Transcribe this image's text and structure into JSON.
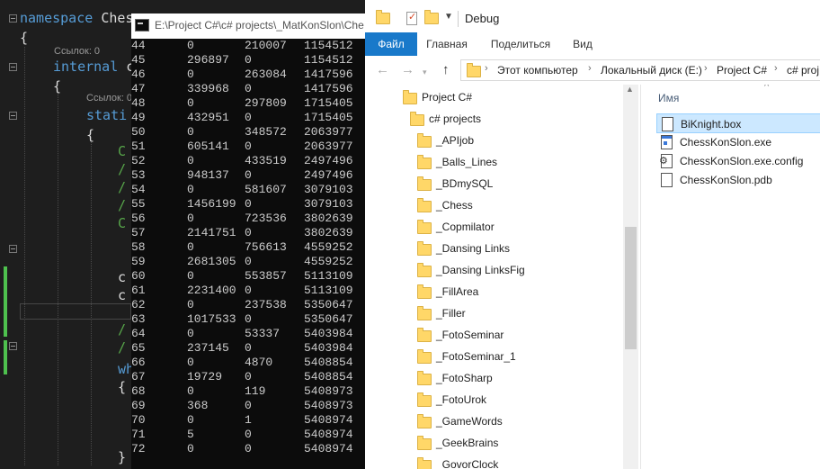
{
  "editor": {
    "lines": [
      [
        {
          "t": "namespace ",
          "k": "kw"
        },
        {
          "t": "Ches",
          "k": "tx"
        }
      ],
      [
        {
          "t": "{",
          "k": "tx"
        }
      ],
      [
        {
          "t": "internal ",
          "k": "kw"
        },
        {
          "t": "c",
          "k": "tx"
        }
      ],
      [
        {
          "t": "{",
          "k": "tx"
        }
      ],
      [
        {
          "t": "stati",
          "k": "kw"
        }
      ],
      [
        {
          "t": "{",
          "k": "tx"
        }
      ],
      [
        {
          "t": "C",
          "k": "cm"
        }
      ],
      [
        {
          "t": "/",
          "k": "cm"
        }
      ],
      [
        {
          "t": "/",
          "k": "cm"
        }
      ],
      [
        {
          "t": "/",
          "k": "cm"
        }
      ],
      [
        {
          "t": "C",
          "k": "cm"
        }
      ],
      [
        {
          "t": "c",
          "k": "tx"
        }
      ],
      [
        {
          "t": "c",
          "k": "tx"
        }
      ],
      [
        {
          "t": "/",
          "k": "cm"
        }
      ],
      [
        {
          "t": "/",
          "k": "cm"
        }
      ],
      [
        {
          "t": "wh",
          "k": "kw"
        }
      ],
      [
        {
          "t": "{",
          "k": "tx"
        }
      ],
      [
        {
          "t": "}",
          "k": "tx"
        }
      ]
    ],
    "refs": [
      "Ссылок: 0",
      "Ссылок: 0"
    ]
  },
  "console": {
    "title": "E:\\Project C#\\c# projects\\_MatKonSlon\\Che",
    "rows": [
      [
        "44",
        "0",
        "210007",
        "1154512"
      ],
      [
        "45",
        "296897",
        "0",
        "1154512"
      ],
      [
        "46",
        "0",
        "263084",
        "1417596"
      ],
      [
        "47",
        "339968",
        "0",
        "1417596"
      ],
      [
        "48",
        "0",
        "297809",
        "1715405"
      ],
      [
        "49",
        "432951",
        "0",
        "1715405"
      ],
      [
        "50",
        "0",
        "348572",
        "2063977"
      ],
      [
        "51",
        "605141",
        "0",
        "2063977"
      ],
      [
        "52",
        "0",
        "433519",
        "2497496"
      ],
      [
        "53",
        "948137",
        "0",
        "2497496"
      ],
      [
        "54",
        "0",
        "581607",
        "3079103"
      ],
      [
        "55",
        "1456199",
        "0",
        "3079103"
      ],
      [
        "56",
        "0",
        "723536",
        "3802639"
      ],
      [
        "57",
        "2141751",
        "0",
        "3802639"
      ],
      [
        "58",
        "0",
        "756613",
        "4559252"
      ],
      [
        "59",
        "2681305",
        "0",
        "4559252"
      ],
      [
        "60",
        "0",
        "553857",
        "5113109"
      ],
      [
        "61",
        "2231400",
        "0",
        "5113109"
      ],
      [
        "62",
        "0",
        "237538",
        "5350647"
      ],
      [
        "63",
        "1017533",
        "0",
        "5350647"
      ],
      [
        "64",
        "0",
        "53337",
        "5403984"
      ],
      [
        "65",
        "237145",
        "0",
        "5403984"
      ],
      [
        "66",
        "0",
        "4870",
        "5408854"
      ],
      [
        "67",
        "19729",
        "0",
        "5408854"
      ],
      [
        "68",
        "0",
        "119",
        "5408973"
      ],
      [
        "69",
        "368",
        "0",
        "5408973"
      ],
      [
        "70",
        "0",
        "1",
        "5408974"
      ],
      [
        "71",
        "5",
        "0",
        "5408974"
      ],
      [
        "72",
        "0",
        "0",
        "5408974"
      ]
    ]
  },
  "explorer": {
    "title": "Debug",
    "tabs": [
      "Файл",
      "Главная",
      "Поделиться",
      "Вид"
    ],
    "breadcrumb": [
      "Этот компьютер",
      "Локальный диск (E:)",
      "Project C#",
      "c# proj"
    ],
    "tree": [
      {
        "label": "Project C#",
        "level": 0
      },
      {
        "label": "c# projects",
        "level": 1
      },
      {
        "label": "_APIjob",
        "level": 2
      },
      {
        "label": "_Balls_Lines",
        "level": 2
      },
      {
        "label": "_BDmySQL",
        "level": 2
      },
      {
        "label": "_Chess",
        "level": 2
      },
      {
        "label": "_Copmilator",
        "level": 2
      },
      {
        "label": "_Dansing Links",
        "level": 2
      },
      {
        "label": "_Dansing LinksFig",
        "level": 2
      },
      {
        "label": "_FillArea",
        "level": 2
      },
      {
        "label": "_Filler",
        "level": 2
      },
      {
        "label": "_FotoSeminar",
        "level": 2
      },
      {
        "label": "_FotoSeminar_1",
        "level": 2
      },
      {
        "label": "_FotoSharp",
        "level": 2
      },
      {
        "label": "_FotoUrok",
        "level": 2
      },
      {
        "label": "_GameWords",
        "level": 2
      },
      {
        "label": "_GeekBrains",
        "level": 2
      },
      {
        "label": "_GovorClock",
        "level": 2
      }
    ],
    "column_header": "Имя",
    "files": [
      {
        "name": "BiKnight.box",
        "icon": "document-icon",
        "selected": true
      },
      {
        "name": "ChessKonSlon.exe",
        "icon": "exe-icon",
        "selected": false
      },
      {
        "name": "ChessKonSlon.exe.config",
        "icon": "config-icon",
        "selected": false
      },
      {
        "name": "ChessKonSlon.pdb",
        "icon": "document-icon",
        "selected": false
      }
    ]
  }
}
